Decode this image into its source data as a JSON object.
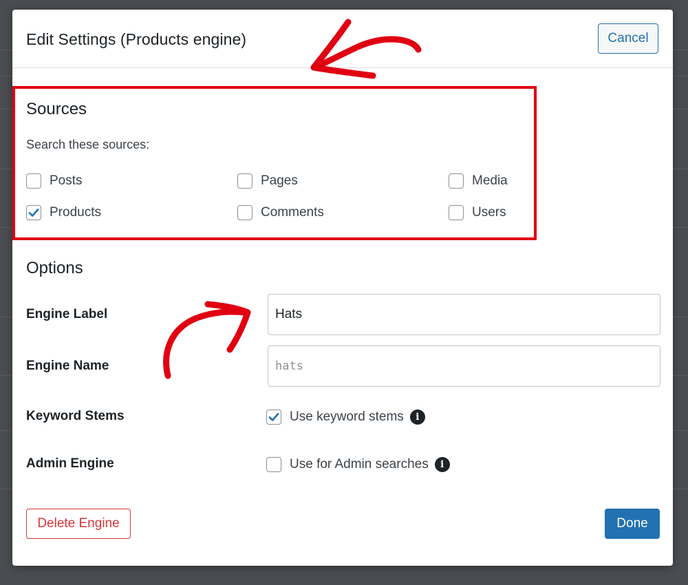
{
  "modal": {
    "title": "Edit Settings (Products engine)",
    "cancel_label": "Cancel"
  },
  "sources": {
    "title": "Sources",
    "help": "Search these sources:",
    "items": [
      {
        "label": "Posts",
        "checked": false
      },
      {
        "label": "Pages",
        "checked": false
      },
      {
        "label": "Media",
        "checked": false
      },
      {
        "label": "Products",
        "checked": true
      },
      {
        "label": "Comments",
        "checked": false
      },
      {
        "label": "Users",
        "checked": false
      }
    ]
  },
  "options": {
    "title": "Options",
    "engine_label": {
      "label": "Engine Label",
      "value": "Hats"
    },
    "engine_name": {
      "label": "Engine Name",
      "value": "hats"
    },
    "keyword_stems": {
      "label": "Keyword Stems",
      "checkbox_label": "Use keyword stems",
      "checked": true
    },
    "admin_engine": {
      "label": "Admin Engine",
      "checkbox_label": "Use for Admin searches",
      "checked": false
    }
  },
  "footer": {
    "delete_label": "Delete Engine",
    "done_label": "Done"
  },
  "colors": {
    "accent": "#2271b1",
    "danger": "#d63638",
    "annotation": "#e00012"
  },
  "icons": {
    "checkmark": "checkmark-icon",
    "info": "info-icon",
    "annotation_arrow": "annotation-arrow-icon"
  }
}
